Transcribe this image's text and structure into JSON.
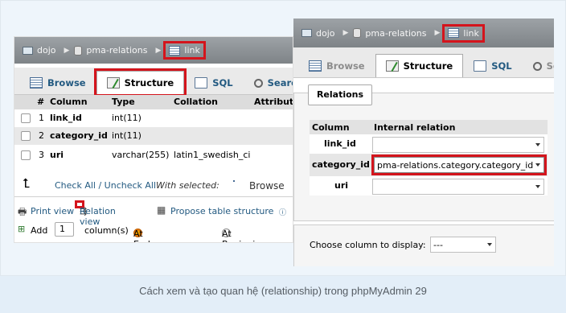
{
  "left": {
    "breadcrumb": [
      "dojo",
      "pma-relations",
      "link"
    ],
    "tabs": [
      "Browse",
      "Structure",
      "SQL",
      "Search"
    ],
    "columns_header": [
      "#",
      "Column",
      "Type",
      "Collation",
      "Attribut"
    ],
    "rows": [
      {
        "num": "1",
        "name": "link_id",
        "type": "int(11)",
        "collation": ""
      },
      {
        "num": "2",
        "name": "category_id",
        "type": "int(11)",
        "collation": ""
      },
      {
        "num": "3",
        "name": "uri",
        "type": "varchar(255)",
        "collation": "latin1_swedish_ci"
      }
    ],
    "check_all": "Check All / Uncheck All",
    "with_selected": "With selected:",
    "browse_label": "Browse",
    "print_view": "Print view",
    "relation_view": "Relation view",
    "propose_structure": "Propose table structure",
    "add_label": "Add",
    "add_count": "1",
    "columns_label": "column(s)",
    "at_end": "At End of Table",
    "at_beginning": "At Beginning"
  },
  "right": {
    "breadcrumb": [
      "dojo",
      "pma-relations",
      "link"
    ],
    "tabs": [
      "Browse",
      "Structure",
      "SQL",
      "Sea"
    ],
    "relations_legend": "Relations",
    "header_column": "Column",
    "header_internal": "Internal relation",
    "rows": [
      {
        "name": "link_id",
        "value": ""
      },
      {
        "name": "category_id",
        "value": "pma-relations.category.category_id"
      },
      {
        "name": "uri",
        "value": ""
      }
    ],
    "display_label": "Choose column to display:",
    "display_value": "---"
  },
  "caption": "Cách xem và tạo quan hệ (relationship) trong phpMyAdmin 29",
  "colors": {
    "highlight": "#d4141c",
    "link": "#235a81",
    "caption_bg": "#e3eef8"
  }
}
